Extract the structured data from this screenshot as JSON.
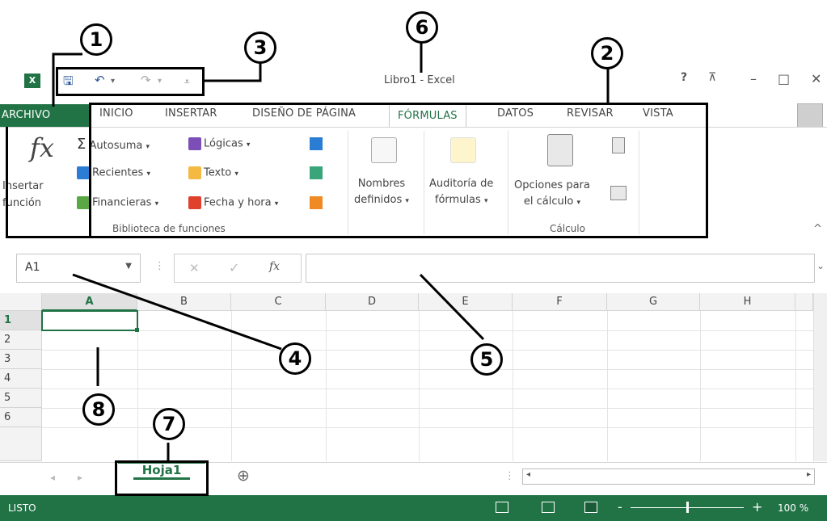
{
  "window": {
    "title": "Libro1 - Excel",
    "help": "?",
    "restore_ribbon": "⊼",
    "minimize": "–",
    "maximize": "□",
    "close": "✕"
  },
  "qat": {
    "app_icon": "X",
    "save": "🖫",
    "undo": "↶",
    "undo_drop": "▾",
    "redo": "↷",
    "redo_drop": "▾",
    "customize": "⩡"
  },
  "tabs": {
    "archivo": "ARCHIVO",
    "inicio": "INICIO",
    "insertar": "INSERTAR",
    "diseno": "DISEÑO DE PÁGINA",
    "formulas": "FÓRMULAS",
    "datos": "DATOS",
    "revisar": "REVISAR",
    "vista": "VISTA"
  },
  "ribbon": {
    "insertar_funcion": {
      "glyph": "fx",
      "line1": "Insertar",
      "line2": "función"
    },
    "autosuma": "Autosuma",
    "recientes": "Recientes",
    "financieras": "Financieras",
    "logicas": "Lógicas",
    "texto": "Texto",
    "fecha_hora": "Fecha y hora",
    "group1": "Biblioteca de funciones",
    "nombres_line1": "Nombres",
    "nombres_line2": "definidos",
    "auditoria_line1": "Auditoría de",
    "auditoria_line2": "fórmulas",
    "opciones_line1": "Opciones para",
    "opciones_line2": "el cálculo",
    "group3": "Cálculo",
    "drop": "▾",
    "collapse": "^"
  },
  "formula_bar": {
    "name_box": "A1",
    "cancel": "✕",
    "enter": "✓",
    "fx": "fx",
    "expand": "⌄"
  },
  "grid": {
    "columns": [
      "A",
      "B",
      "C",
      "D",
      "E",
      "F",
      "G",
      "H"
    ],
    "rows": [
      "1",
      "2",
      "3",
      "4",
      "5",
      "6"
    ]
  },
  "sheets": {
    "prev": "◂",
    "next": "▸",
    "active_sheet": "Hoja1",
    "add": "⊕"
  },
  "status": {
    "state": "LISTO",
    "zoom": "100 %",
    "zoom_minus": "-",
    "zoom_plus": "+"
  },
  "annotations": [
    "1",
    "2",
    "3",
    "4",
    "5",
    "6",
    "7",
    "8"
  ],
  "colors": {
    "excel_green": "#217346",
    "active_tab_text": "#217346"
  }
}
